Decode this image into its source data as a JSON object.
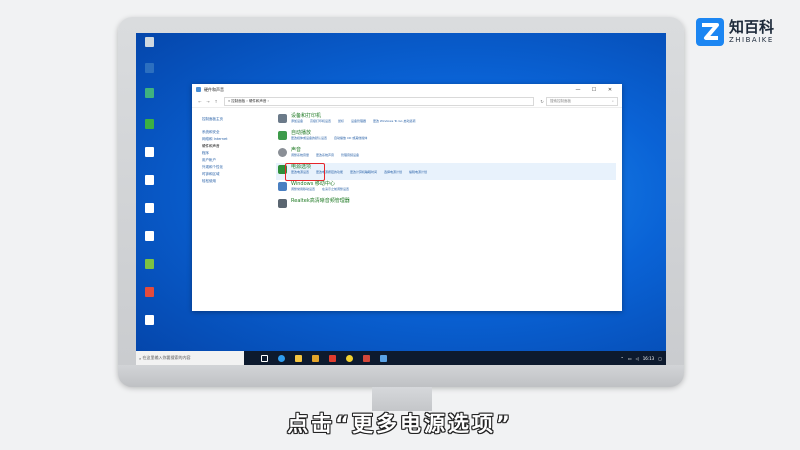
{
  "logo": {
    "cn": "知百科",
    "en": "ZHIBAIKE"
  },
  "subtitle": "点击“更多电源选项”",
  "window": {
    "title": "硬件和声音",
    "address": "« 控制面板 › 硬件和声音 ›",
    "search_placeholder": "搜索控制面板",
    "controls": {
      "minimize": "—",
      "maximize": "☐",
      "close": "✕"
    },
    "sidebar": [
      "控制面板主页",
      "系统和安全",
      "网络和 Internet",
      "硬件和声音",
      "程序",
      "用户帐户",
      "外观和个性化",
      "时钟和区域",
      "轻松使用"
    ],
    "categories": [
      {
        "title": "设备和打印机",
        "links": [
          "添加设备",
          "高级打印机设置",
          "鼠标",
          "设备管理器",
          "更改 Windows To Go 启动选项"
        ]
      },
      {
        "title": "自动播放",
        "links": [
          "更改媒体或设备的默认设置",
          "自动播放 CD 或其他媒体"
        ]
      },
      {
        "title": "声音",
        "links": [
          "调整系统音量",
          "更改系统声音",
          "管理音频设备"
        ]
      },
      {
        "title": "电源选项",
        "links": [
          "更改电源设置",
          "更改电源按钮的功能",
          "更改计算机睡眠时间",
          "选择电源计划",
          "编辑电源计划"
        ]
      },
      {
        "title": "Windows 移动中心",
        "links": [
          "调整常用移动设置",
          "在演示之前调整设置"
        ]
      },
      {
        "title": "Realtek高清晰音频管理器",
        "links": []
      }
    ]
  },
  "taskbar": {
    "search_placeholder": "在这里输入你要搜索的内容",
    "clock": "16:13"
  },
  "colors": {
    "accent": "#1c86f2",
    "link": "#2a62a8",
    "category_title": "#1f7a24",
    "highlight_box": "#e5252a"
  }
}
